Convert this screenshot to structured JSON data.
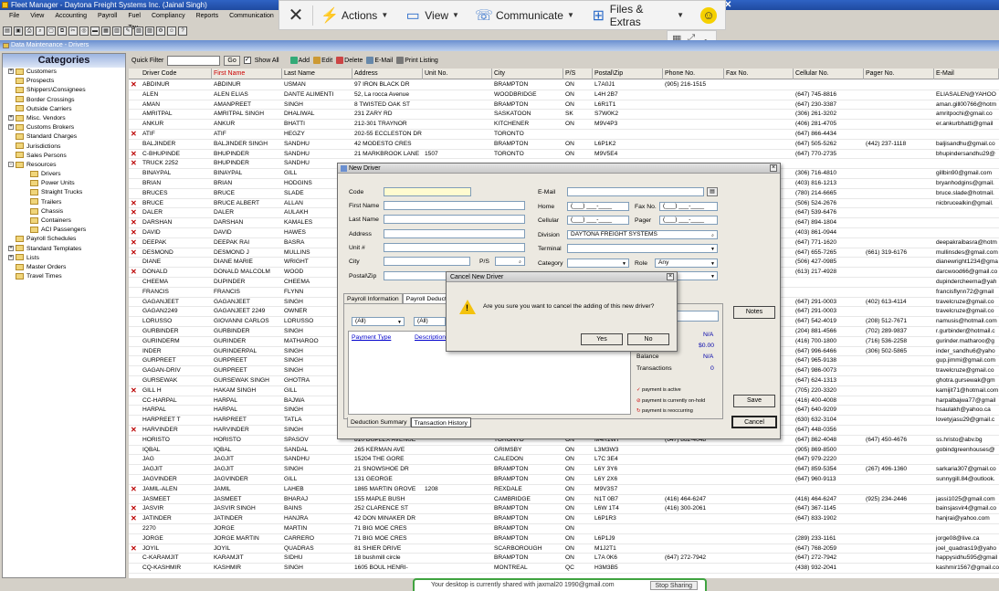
{
  "window": {
    "title": "Fleet Manager - Daytona Freight Systems Inc. (Jainal Singh)",
    "close": "✕"
  },
  "menu": [
    "File",
    "View",
    "Accounting",
    "Payroll",
    "Fuel Tax",
    "Compliancy",
    "Reports",
    "Communication"
  ],
  "overlay": {
    "close": "✕",
    "actions": "Actions",
    "view": "View",
    "communicate": "Communicate",
    "files": "Files & Extras"
  },
  "panel_title": "Data Maintenance - Drivers",
  "categories": {
    "title": "Categories",
    "items": [
      {
        "label": "Customers",
        "level": 0,
        "pm": "+"
      },
      {
        "label": "Prospects",
        "level": 0,
        "pm": ""
      },
      {
        "label": "Shippers\\Consignees",
        "level": 0,
        "pm": ""
      },
      {
        "label": "Border Crossings",
        "level": 0,
        "pm": ""
      },
      {
        "label": "Outside Carriers",
        "level": 0,
        "pm": ""
      },
      {
        "label": "Misc. Vendors",
        "level": 0,
        "pm": "+"
      },
      {
        "label": "Customs Brokers",
        "level": 0,
        "pm": "+"
      },
      {
        "label": "Standard Charges",
        "level": 0,
        "pm": ""
      },
      {
        "label": "Jurisdictions",
        "level": 0,
        "pm": ""
      },
      {
        "label": "Sales Persons",
        "level": 0,
        "pm": ""
      },
      {
        "label": "Resources",
        "level": 0,
        "pm": "-"
      },
      {
        "label": "Drivers",
        "level": 1,
        "pm": ""
      },
      {
        "label": "Power Units",
        "level": 1,
        "pm": ""
      },
      {
        "label": "Straight Trucks",
        "level": 1,
        "pm": ""
      },
      {
        "label": "Trailers",
        "level": 1,
        "pm": ""
      },
      {
        "label": "Chassis",
        "level": 1,
        "pm": ""
      },
      {
        "label": "Containers",
        "level": 1,
        "pm": ""
      },
      {
        "label": "ACI Passengers",
        "level": 1,
        "pm": ""
      },
      {
        "label": "Payroll Schedules",
        "level": 0,
        "pm": ""
      },
      {
        "label": "Standard Templates",
        "level": 0,
        "pm": "+"
      },
      {
        "label": "Lists",
        "level": 0,
        "pm": "+"
      },
      {
        "label": "Master Orders",
        "level": 0,
        "pm": ""
      },
      {
        "label": "Travel Times",
        "level": 0,
        "pm": ""
      }
    ]
  },
  "filter": {
    "label": "Quick Filter",
    "go": "Go",
    "show_all": "Show All",
    "add": "Add",
    "edit": "Edit",
    "delete": "Delete",
    "email": "E-Mail",
    "print": "Print Listing"
  },
  "columns": [
    "Driver Code",
    "First Name",
    "Last Name",
    "Address",
    "Unit No.",
    "City",
    "P/S",
    "Postal\\Zip",
    "Phone No.",
    "Fax No.",
    "Cellular No.",
    "Pager No.",
    "E-Mail"
  ],
  "rows": [
    {
      "x": true,
      "c": [
        "ABDINUR",
        "ABDINUR",
        "USMAN",
        "97 IRON BLACK DR",
        "",
        "BRAMPTON",
        "ON",
        "L7A0J1",
        "(905) 216-1515",
        "",
        "",
        "",
        ""
      ]
    },
    {
      "x": false,
      "c": [
        "ALEN",
        "ALEN ELIAS",
        "DANTE ALIMENTI",
        "52, La rocca Avenue",
        "",
        "WOODBRIDGE",
        "ON",
        "L4H 2B7",
        "",
        "",
        "(647) 745-8816",
        "",
        "ELIASALEN@YAHOO"
      ]
    },
    {
      "x": false,
      "c": [
        "AMAN",
        "AMANPREET",
        "SINGH",
        "8 TWISTED OAK ST",
        "",
        "BRAMPTON",
        "ON",
        "L6R1T1",
        "",
        "",
        "(647) 230-3387",
        "",
        "aman.gill00766@hotm"
      ]
    },
    {
      "x": false,
      "c": [
        "AMRITPAL",
        "AMRITPAL SINGH",
        "DHALIWAL",
        "231 ZARY RD",
        "",
        "SASKATOON",
        "SK",
        "S7W0K2",
        "",
        "",
        "(306) 261-3202",
        "",
        "amritpochi@gmail.co"
      ]
    },
    {
      "x": false,
      "c": [
        "ANKUR",
        "ANKUR",
        "BHATTI",
        "212-301 TRAYNOR",
        "",
        "KITCHENER",
        "ON",
        "M9V4P3",
        "",
        "",
        "(406) 281-4705",
        "",
        "er.ankurbhatti@gmail"
      ]
    },
    {
      "x": true,
      "c": [
        "ATIF",
        "ATIF",
        "HEGZY",
        "202-55 ECCLESTON DR",
        "",
        "TORONTO",
        "",
        "",
        "",
        "",
        "(647) 866-4434",
        "",
        ""
      ]
    },
    {
      "x": false,
      "c": [
        "BALJINDER",
        "BALJINDER SINGH",
        "SANDHU",
        "42 MODESTO CRES",
        "",
        "BRAMPTON",
        "ON",
        "L6P1K2",
        "",
        "",
        "(647) 505-5262",
        "(442) 237-1118",
        "baljisandhu@gmail.co"
      ]
    },
    {
      "x": true,
      "c": [
        "C-BHUPINDE",
        "BHUPINDER",
        "SANDHU",
        "21 MARKBROOK LANE",
        "1507",
        "TORONTO",
        "ON",
        "M9V5E4",
        "",
        "",
        "(647) 770-2735",
        "",
        "bhupindersandhu29@"
      ]
    },
    {
      "x": true,
      "c": [
        "TRUCK 2252",
        "BHUPINDER",
        "SANDHU",
        "",
        "",
        "",
        "",
        "",
        "",
        "",
        "",
        "",
        ""
      ]
    },
    {
      "x": false,
      "c": [
        "BINAYPAL",
        "BINAYPAL",
        "GILL",
        "",
        "",
        "",
        "",
        "",
        "",
        "",
        "(306) 716-4810",
        "",
        "gillbin90@gmail.com"
      ]
    },
    {
      "x": false,
      "c": [
        "BRIAN",
        "BRIAN",
        "HODGINS",
        "",
        "",
        "",
        "",
        "",
        "",
        "",
        "(403) 816-1213",
        "",
        "bryanhodgins@gmail."
      ]
    },
    {
      "x": false,
      "c": [
        "BRUCES",
        "BRUCE",
        "SLADE",
        "",
        "",
        "",
        "",
        "",
        "",
        "",
        "(780) 214-6665",
        "",
        "bruce.slade@hotmail."
      ]
    },
    {
      "x": true,
      "c": [
        "BRUCE",
        "BRUCE ALBERT",
        "ALLAN",
        "",
        "",
        "",
        "",
        "",
        "",
        "",
        "(506) 524-2676",
        "",
        "nicbrucealkin@gmail."
      ]
    },
    {
      "x": true,
      "c": [
        "DALER",
        "DALER",
        "AULAKH",
        "",
        "",
        "",
        "",
        "",
        "",
        "",
        "(647) 539-6476",
        "",
        ""
      ]
    },
    {
      "x": true,
      "c": [
        "DARSHAN",
        "DARSHAN",
        "KAMALES",
        "",
        "",
        "",
        "",
        "",
        "",
        "",
        "(647) 894-1804",
        "",
        ""
      ]
    },
    {
      "x": true,
      "c": [
        "DAVID",
        "DAVID",
        "HAWES",
        "",
        "",
        "",
        "",
        "",
        "",
        "",
        "(403) 861-0944",
        "",
        ""
      ]
    },
    {
      "x": true,
      "c": [
        "DEEPAK",
        "DEEPAK RAI",
        "BASRA",
        "",
        "",
        "",
        "",
        "",
        "",
        "",
        "(647) 771-1620",
        "",
        "deepakraibasra@hotm"
      ]
    },
    {
      "x": true,
      "c": [
        "DESMOND",
        "DESMOND J",
        "MULLINS",
        "",
        "",
        "",
        "",
        "",
        "",
        "",
        "(647) 655-7265",
        "(661) 319-6176",
        "mullinsdes@gmail.com"
      ]
    },
    {
      "x": false,
      "c": [
        "DIANE",
        "DIANE MARIE",
        "WRIGHT",
        "",
        "",
        "",
        "",
        "",
        "",
        "",
        "(506) 427-0985",
        "",
        "dianewright1234@gma"
      ]
    },
    {
      "x": true,
      "c": [
        "DONALD",
        "DONALD MALCOLM",
        "WOOD",
        "",
        "",
        "",
        "",
        "",
        "",
        "",
        "(613) 217-4928",
        "",
        "darcwood66@gmail.co"
      ]
    },
    {
      "x": false,
      "c": [
        "CHEEMA",
        "DUPINDER",
        "CHEEMA",
        "",
        "",
        "",
        "",
        "",
        "",
        "",
        "",
        "",
        "dupindercheema@yah"
      ]
    },
    {
      "x": false,
      "c": [
        "FRANCIS",
        "FRANCIS",
        "FLYNN",
        "",
        "",
        "",
        "",
        "",
        "",
        "",
        "",
        "",
        "francisflynn72@gmail"
      ]
    },
    {
      "x": false,
      "c": [
        "GAGANJEET",
        "GAGANJEET",
        "SINGH",
        "",
        "",
        "",
        "",
        "",
        "",
        "",
        "(647) 291-0003",
        "(402) 613-4114",
        "travelcruze@gmail.co"
      ]
    },
    {
      "x": false,
      "c": [
        "GAGAN2249",
        "GAGANJEET 2249",
        "OWNER",
        "",
        "",
        "",
        "",
        "",
        "",
        "",
        "(647) 291-0003",
        "",
        "travelcruze@gmail.co"
      ]
    },
    {
      "x": false,
      "c": [
        "LORUSSO",
        "GIOVANNI CARLOS",
        "LORUSSO",
        "",
        "",
        "",
        "",
        "",
        "",
        "",
        "(647) 542-4019",
        "(208) 512-7671",
        "namusis@hotmail.com"
      ]
    },
    {
      "x": false,
      "c": [
        "GURBINDER",
        "GURBINDER",
        "SINGH",
        "",
        "",
        "",
        "",
        "",
        "",
        "",
        "(204) 881-4566",
        "(702) 289-9837",
        "r.gurbinder@hotmail.c"
      ]
    },
    {
      "x": false,
      "c": [
        "GURINDERM",
        "GURINDER",
        "MATHAROO",
        "",
        "",
        "",
        "",
        "",
        "",
        "",
        "(416) 700-1800",
        "(716) 536-2258",
        "gurinder.matharoo@g"
      ]
    },
    {
      "x": false,
      "c": [
        "INDER",
        "GURINDERPAL",
        "SINGH",
        "",
        "",
        "",
        "",
        "",
        "",
        "",
        "(647) 996-6466",
        "(306) 502-5865",
        "inder_sandhu6@yaho"
      ]
    },
    {
      "x": false,
      "c": [
        "GURPREET",
        "GURPREET",
        "SINGH",
        "",
        "",
        "",
        "",
        "",
        "",
        "",
        "(647) 965-9138",
        "",
        "gup.jimmi@gmail.com"
      ]
    },
    {
      "x": false,
      "c": [
        "GAGAN-DRIV",
        "GURPREET",
        "SINGH",
        "",
        "",
        "",
        "",
        "",
        "",
        "",
        "(647) 986-0073",
        "",
        "travelcruze@gmail.co"
      ]
    },
    {
      "x": false,
      "c": [
        "GURSEWAK",
        "GURSEWAK SINGH",
        "GHOTRA",
        "",
        "",
        "",
        "",
        "",
        "",
        "",
        "(647) 624-1313",
        "",
        "ghotra.gursewak@gm"
      ]
    },
    {
      "x": true,
      "c": [
        "GILL H",
        "HAKAM SINGH",
        "GILL",
        "",
        "",
        "",
        "",
        "",
        "",
        "",
        "(705) 220-3320",
        "",
        "kamijit71@hotmail.com"
      ]
    },
    {
      "x": false,
      "c": [
        "CC-HARPAL",
        "HARPAL",
        "BAJWA",
        "",
        "",
        "",
        "",
        "",
        "",
        "",
        "(416) 400-4008",
        "",
        "harpalbajwa77@gmail"
      ]
    },
    {
      "x": false,
      "c": [
        "HARPAL",
        "HARPAL",
        "SINGH",
        "",
        "",
        "",
        "",
        "",
        "",
        "",
        "(647) 640-9209",
        "",
        "hsaulakh@yahoo.ca"
      ]
    },
    {
      "x": false,
      "c": [
        "HARPREET T",
        "HARPREET",
        "TATLA",
        "",
        "",
        "",
        "",
        "",
        "",
        "",
        "(630) 632-3104",
        "",
        "lovetyjasu29@gmail.c"
      ]
    },
    {
      "x": true,
      "c": [
        "HARVINDER",
        "HARVINDER",
        "SINGH",
        "",
        "",
        "",
        "",
        "",
        "",
        "",
        "(647) 448-0356",
        "",
        ""
      ]
    },
    {
      "x": false,
      "c": [
        "HORISTO",
        "HORISTO",
        "SPASOV",
        "810 DUPLEX AVENUE",
        "",
        "TORONTO",
        "ON",
        "M4R1W7",
        "(647) 862-4048",
        "",
        "(647) 862-4048",
        "(647) 450-4676",
        "ss.hristo@abv.bg"
      ]
    },
    {
      "x": false,
      "c": [
        "IQBAL",
        "IQBAL",
        "SANDAL",
        "265 KERMAN AVE",
        "",
        "GRIMSBY",
        "ON",
        "L3M3W3",
        "",
        "",
        "(905) 869-8500",
        "",
        "gobindgreenhouses@"
      ]
    },
    {
      "x": false,
      "c": [
        "JAG",
        "JAGJIT",
        "SANDHU",
        "15204 THE GORE",
        "",
        "CALEDON",
        "ON",
        "L7C 3E4",
        "",
        "",
        "(647) 979-2220",
        "",
        ""
      ]
    },
    {
      "x": false,
      "c": [
        "JAGJIT",
        "JAGJIT",
        "SINGH",
        "21 SNOWSHOE DR",
        "",
        "BRAMPTON",
        "ON",
        "L6Y 3Y6",
        "",
        "",
        "(647) 859-5354",
        "(267) 496-1360",
        "sarkaria307@gmail.co"
      ]
    },
    {
      "x": false,
      "c": [
        "JAGVINDER",
        "JAGVINDER",
        "GILL",
        "131 GEORGE",
        "",
        "BRAMPTON",
        "ON",
        "L6Y 2X6",
        "",
        "",
        "(647) 960-9113",
        "",
        "sunnygill.84@outlook."
      ]
    },
    {
      "x": true,
      "c": [
        "JAMIL-ALEN",
        "JAMIL",
        "LAHEB",
        "1865 MARTIN GROVE",
        "1208",
        "REXDALE",
        "ON",
        "M9V3S7",
        "",
        "",
        "",
        "",
        ""
      ]
    },
    {
      "x": false,
      "c": [
        "JASMEET",
        "JASMEET",
        "BHARAJ",
        "155 MAPLE BUSH",
        "",
        "CAMBRIDGE",
        "ON",
        "N1T 0B7",
        "(416) 464-6247",
        "",
        "(416) 464-6247",
        "(925) 234-2446",
        "jassi1025@gmail.com"
      ]
    },
    {
      "x": true,
      "c": [
        "JASVIR",
        "JASVIR SINGH",
        "BAINS",
        "252 CLARENCE ST",
        "",
        "BRAMPTON",
        "ON",
        "L6W 1T4",
        "(416) 300-2061",
        "",
        "(647) 367-1145",
        "",
        "bainsjasvir4@gmail.co"
      ]
    },
    {
      "x": true,
      "c": [
        "JATINDER",
        "JATINDER",
        "HANJRA",
        "42 DON MINAKER DR",
        "",
        "BRAMPTON",
        "ON",
        "L6P1R3",
        "",
        "",
        "(647) 833-1902",
        "",
        "hanjrai@yahoo.com"
      ]
    },
    {
      "x": false,
      "c": [
        "2270",
        "JORGE",
        "MARTIN",
        "71 BIG MOE CRES",
        "",
        "BRAMPTON",
        "ON",
        "",
        "",
        "",
        "",
        "",
        ""
      ]
    },
    {
      "x": false,
      "c": [
        "JORGE",
        "JORGE MARTIN",
        "CARRERO",
        "71 BIG MOE CRES",
        "",
        "BRAMPTON",
        "ON",
        "L6P1J9",
        "",
        "",
        "(289) 233-1161",
        "",
        "jorge08@live.ca"
      ]
    },
    {
      "x": true,
      "c": [
        "JOYIL",
        "JOYIL",
        "QUADRAS",
        "81 SHIER DRIVE",
        "",
        "SCARBOROUGH",
        "ON",
        "M1J2T1",
        "",
        "",
        "(647) 768-2059",
        "",
        "joel_quadras19@yaho"
      ]
    },
    {
      "x": false,
      "c": [
        "C-KARAMJIT",
        "KARAMJIT",
        "SIDHU",
        "18 bushmill circle",
        "",
        "BRAMPTON",
        "ON",
        "L7A 0K6",
        "(647) 272-7942",
        "",
        "(647) 272-7942",
        "",
        "happysidhu595@gmail"
      ]
    },
    {
      "x": false,
      "c": [
        "CQ-KASHMIR",
        "KASHMIR",
        "SINGH",
        "1605 BOUL HENRI-",
        "",
        "MONTREAL",
        "QC",
        "H3M3B5",
        "",
        "",
        "(438) 932-2041",
        "",
        "kashmir1567@gmail.co"
      ]
    }
  ],
  "new_driver": {
    "title": "New Driver",
    "labels": {
      "code": "Code",
      "first": "First Name",
      "last": "Last Name",
      "address": "Address",
      "unit": "Unit #",
      "city": "City",
      "ps": "P/S",
      "postal": "Postal\\Zip",
      "email": "E-Mail",
      "home": "Home",
      "fax": "Fax No.",
      "cell": "Cellular",
      "pager": "Pager",
      "division": "Division",
      "terminal": "Terminal",
      "category": "Category",
      "role": "Role"
    },
    "phone_mask": "(___) ___-____",
    "division_value": "DAYTONA FREIGHT SYSTEMS",
    "role_value": "Any",
    "tabs": [
      "Payroll Information",
      "Payroll Deduct"
    ],
    "filter1": "(All)",
    "filter2": "(All)",
    "col_payment": "Payment Type",
    "col_desc": "Description",
    "summary": {
      "na1": "N/A",
      "amount": "$0.00",
      "balance_label": "Balance",
      "na2": "N/A",
      "trans_label": "Transactions",
      "trans_value": "0"
    },
    "legend": [
      "payment is active",
      "payment is currently on-hold",
      "payment is reoccurring"
    ],
    "bottom_tabs": [
      "Deduction Summary",
      "Transaction History"
    ],
    "buttons": {
      "notes": "Notes",
      "save": "Save",
      "cancel": "Cancel"
    }
  },
  "cancel_dialog": {
    "title": "Cancel New Driver",
    "message": "Are you sure you want to cancel the adding of this new driver?",
    "yes": "Yes",
    "no": "No"
  },
  "share_bar": {
    "text": "Your desktop is currently shared with jaxmal20 1990@gmail.com",
    "stop": "Stop Sharing"
  }
}
